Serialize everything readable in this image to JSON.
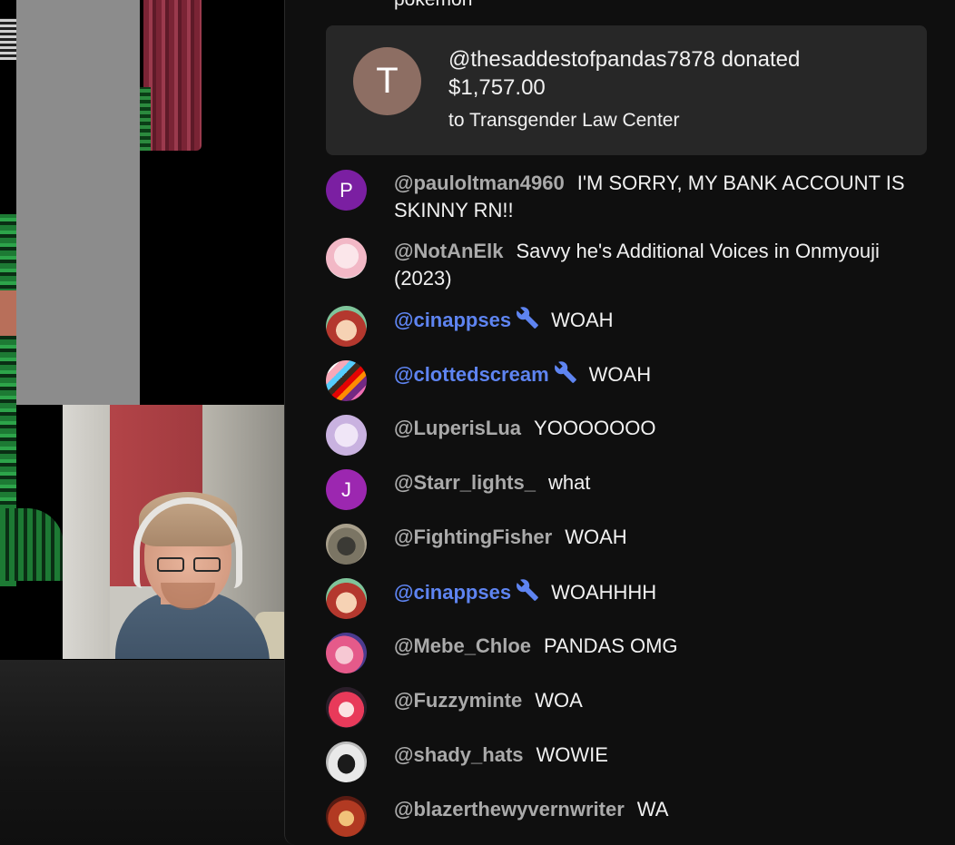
{
  "previous_message_tail": "pokemon",
  "donation": {
    "avatar_letter": "T",
    "avatar_color": "#8d6e63",
    "text": "@thesaddestofpandas7878 donated $1,757.00",
    "subtext": "to Transgender Law Center"
  },
  "colors": {
    "author": "#aaaaaa",
    "moderator": "#5e84f1",
    "message": "#f1f1f1",
    "panel": "#0f0f0f",
    "donation_card": "#272727"
  },
  "messages": [
    {
      "author": "@pauloltman4960",
      "text": "I'M SORRY, MY BANK ACCOUNT IS SKINNY RN!!",
      "moderator": false,
      "avatar": "letter-P"
    },
    {
      "author": "@NotAnElk",
      "text": "Savvy he's Additional Voices in Onmyouji (2023)",
      "moderator": false,
      "avatar": "pink-character"
    },
    {
      "author": "@cinappses",
      "text": "WOAH",
      "moderator": true,
      "avatar": "redhead-character"
    },
    {
      "author": "@clottedscream",
      "text": "WOAH",
      "moderator": true,
      "avatar": "pride-flag"
    },
    {
      "author": "@LuperisLua",
      "text": "YOOOOOOO",
      "moderator": false,
      "avatar": "lilac-sketch"
    },
    {
      "author": "@Starr_lights_",
      "text": "what",
      "moderator": false,
      "avatar": "letter-J"
    },
    {
      "author": "@FightingFisher",
      "text": "WOAH",
      "moderator": false,
      "avatar": "animal-photo"
    },
    {
      "author": "@cinappses",
      "text": "WOAHHHH",
      "moderator": true,
      "avatar": "redhead-character"
    },
    {
      "author": "@Mebe_Chloe",
      "text": "PANDAS OMG",
      "moderator": false,
      "avatar": "pink-hair-character"
    },
    {
      "author": "@Fuzzyminte",
      "text": "WOA",
      "moderator": false,
      "avatar": "red-character"
    },
    {
      "author": "@shady_hats",
      "text": "WOWIE",
      "moderator": false,
      "avatar": "sunglasses"
    },
    {
      "author": "@blazerthewyvernwriter",
      "text": "WA",
      "moderator": false,
      "avatar": "dragon-character"
    }
  ],
  "avatar_letters": {
    "letter-P": "P",
    "letter-J": "J"
  }
}
